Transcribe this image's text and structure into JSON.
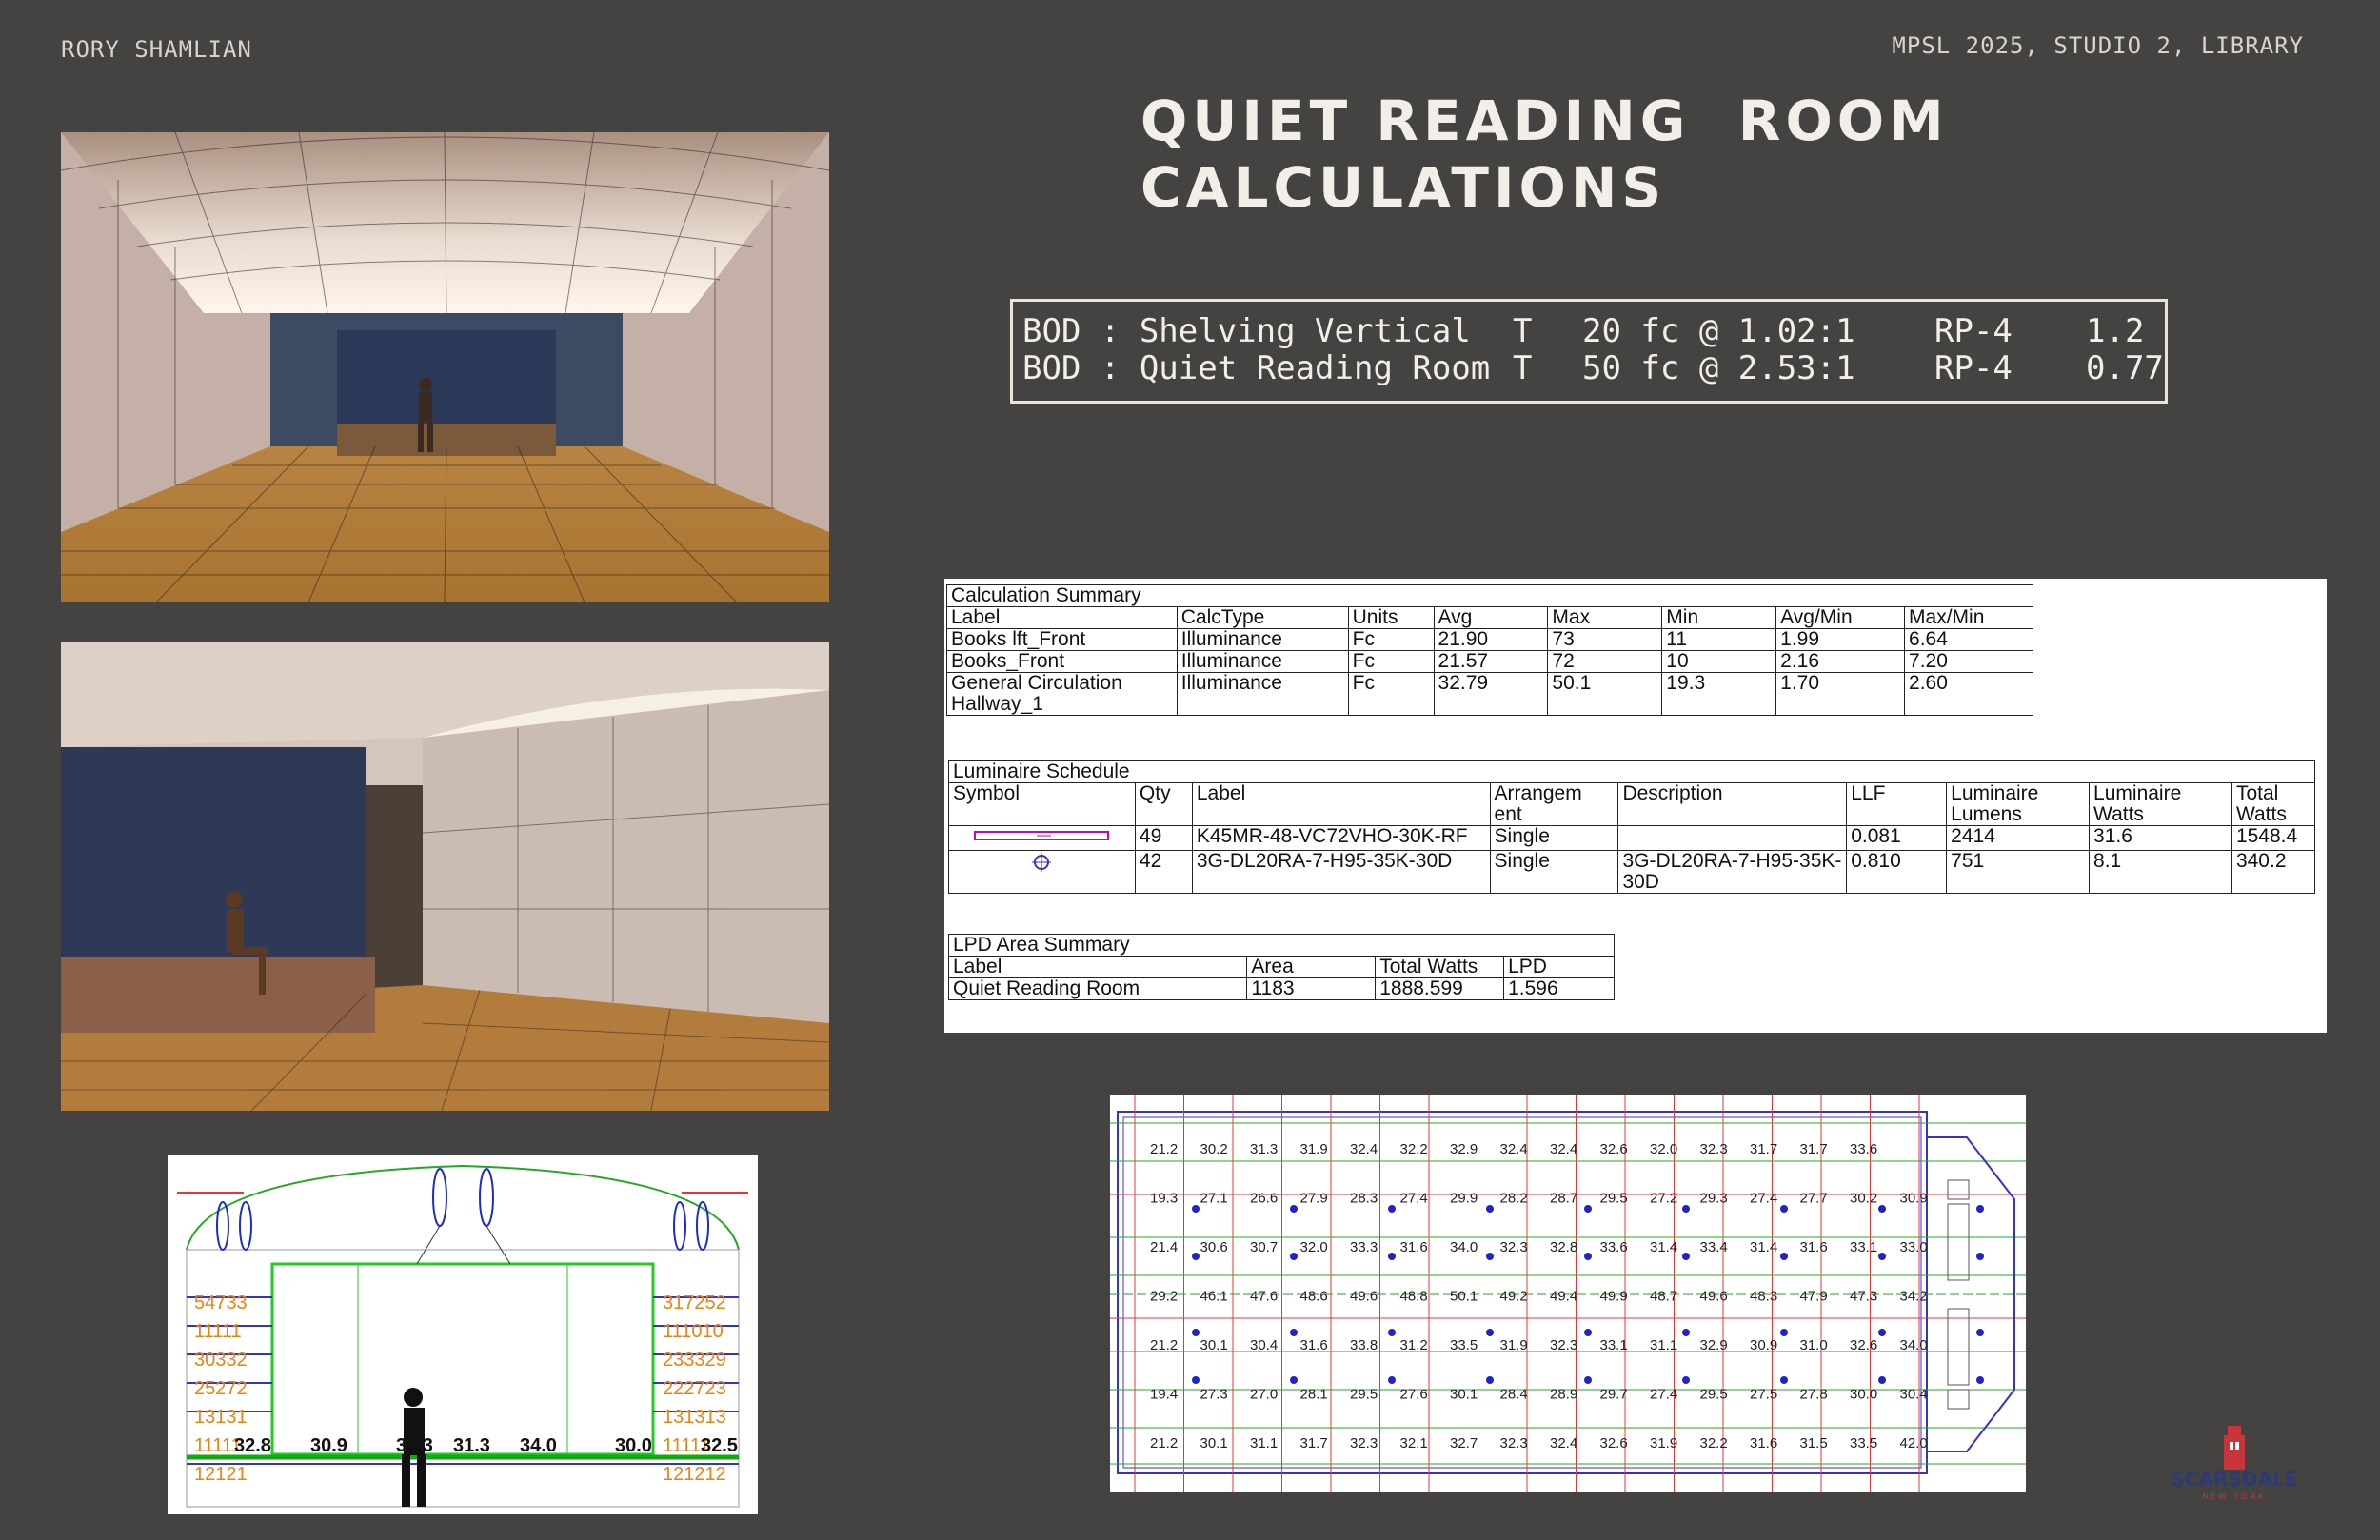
{
  "header": {
    "author": "RORY SHAMLIAN",
    "project": "MPSL 2025, STUDIO 2, LIBRARY",
    "title_line1": "QUIET READING  ROOM",
    "title_line2": "CALCULATIONS"
  },
  "bod": [
    {
      "name": "BOD : Shelving Vertical",
      "t": "T",
      "target": "20 fc @ 1.02:1",
      "rp": "RP-4",
      "val": "1.2"
    },
    {
      "name": "BOD : Quiet Reading Room",
      "t": "T",
      "target": "50 fc @ 2.53:1",
      "rp": "RP-4",
      "val": "0.77"
    }
  ],
  "calc_summary": {
    "title": "Calculation Summary",
    "headers": [
      "Label",
      "CalcType",
      "Units",
      "Avg",
      "Max",
      "Min",
      "Avg/Min",
      "Max/Min"
    ],
    "rows": [
      [
        "Books lft_Front",
        "Illuminance",
        "Fc",
        "21.90",
        "73",
        "11",
        "1.99",
        "6.64"
      ],
      [
        "Books_Front",
        "Illuminance",
        "Fc",
        "21.57",
        "72",
        "10",
        "2.16",
        "7.20"
      ],
      [
        "General Circulation Hallway_1",
        "Illuminance",
        "Fc",
        "32.79",
        "50.1",
        "19.3",
        "1.70",
        "2.60"
      ]
    ]
  },
  "luminaire_schedule": {
    "title": "Luminaire Schedule",
    "headers": [
      "Symbol",
      "Qty",
      "Label",
      "Arrangem ent",
      "Description",
      "LLF",
      "Luminaire Lumens",
      "Luminaire Watts",
      "Total Watts"
    ],
    "rows": [
      [
        "linear-fixture-symbol",
        "49",
        "K45MR-48-VC72VHO-30K-RF",
        "Single",
        "",
        "0.081",
        "2414",
        "31.6",
        "1548.4"
      ],
      [
        "downlight-symbol",
        "42",
        "3G-DL20RA-7-H95-35K-30D",
        "Single",
        "3G-DL20RA-7-H95-35K-30D",
        "0.810",
        "751",
        "8.1",
        "340.2"
      ]
    ]
  },
  "lpd_summary": {
    "title": "LPD Area Summary",
    "headers": [
      "Label",
      "Area",
      "Total Watts",
      "LPD"
    ],
    "rows": [
      [
        "Quiet Reading Room",
        "1183",
        "1888.599",
        "1.596"
      ]
    ]
  },
  "section": {
    "left_values": [
      "54733",
      "11111",
      "30332",
      "25272",
      "13131",
      "11111",
      "12121"
    ],
    "right_values": [
      "317252",
      "111010",
      "233329",
      "222723",
      "131313",
      "11111",
      "121212"
    ],
    "floor_values": [
      "32.8",
      "30.9",
      "33.3",
      "31.3",
      "34.0",
      "30.0",
      "32.5"
    ]
  },
  "plan": {
    "rows": [
      [
        "21.2",
        "30.2",
        "31.3",
        "31.9",
        "32.4",
        "32.2",
        "32.9",
        "32.4",
        "32.4",
        "32.6",
        "32.0",
        "32.3",
        "31.7",
        "31.7",
        "33.6"
      ],
      [
        "19.3",
        "27.1",
        "26.6",
        "27.9",
        "28.3",
        "27.4",
        "29.9",
        "28.2",
        "28.7",
        "29.5",
        "27.2",
        "29.3",
        "27.4",
        "27.7",
        "30.2",
        "30.9"
      ],
      [
        "21.4",
        "30.6",
        "30.7",
        "32.0",
        "33.3",
        "31.6",
        "34.0",
        "32.3",
        "32.8",
        "33.6",
        "31.4",
        "33.4",
        "31.4",
        "31.6",
        "33.1",
        "33.0"
      ],
      [
        "29.2",
        "46.1",
        "47.6",
        "48.6",
        "49.6",
        "48.8",
        "50.1",
        "49.2",
        "49.4",
        "49.9",
        "48.7",
        "49.6",
        "48.3",
        "47.9",
        "47.3",
        "34.2"
      ],
      [
        "21.2",
        "30.1",
        "30.4",
        "31.6",
        "33.8",
        "31.2",
        "33.5",
        "31.9",
        "32.3",
        "33.1",
        "31.1",
        "32.9",
        "30.9",
        "31.0",
        "32.6",
        "34.0"
      ],
      [
        "19.4",
        "27.3",
        "27.0",
        "28.1",
        "29.5",
        "27.6",
        "30.1",
        "28.4",
        "28.9",
        "29.7",
        "27.4",
        "29.5",
        "27.5",
        "27.8",
        "30.0",
        "30.4"
      ],
      [
        "21.2",
        "30.1",
        "31.1",
        "31.7",
        "32.3",
        "32.1",
        "32.7",
        "32.3",
        "32.4",
        "32.6",
        "31.9",
        "32.2",
        "31.6",
        "31.5",
        "33.5",
        "42.0"
      ]
    ]
  },
  "logo": {
    "name": "SCARSDALE",
    "sub": "NEW YORK"
  }
}
